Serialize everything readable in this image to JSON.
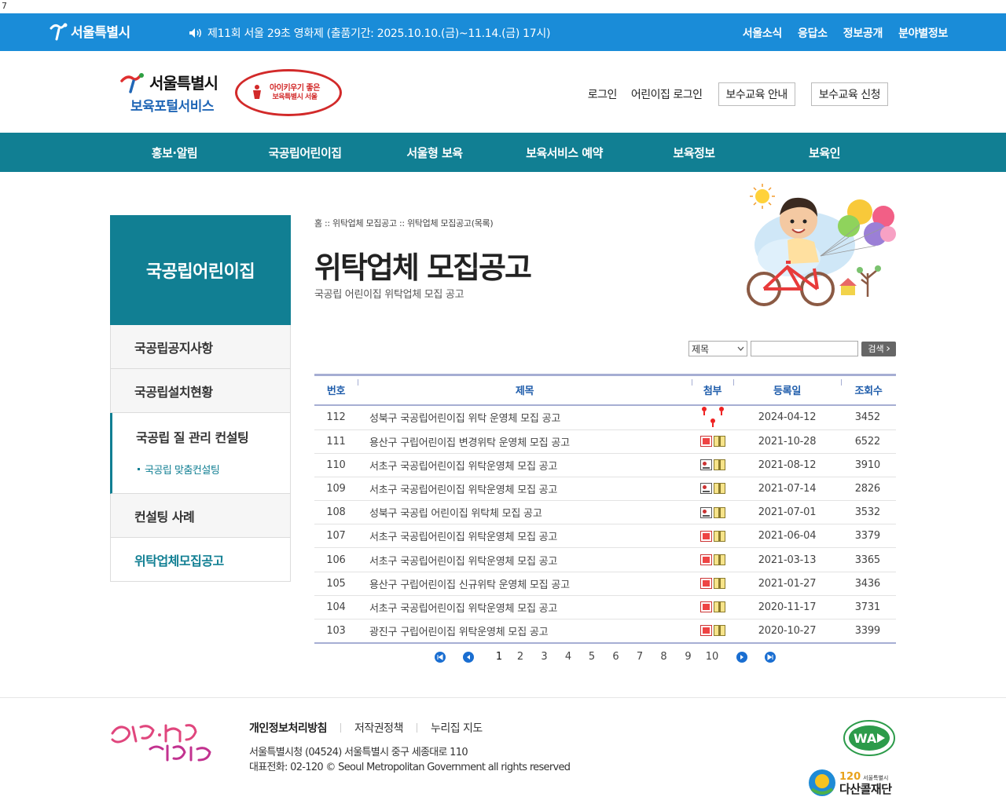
{
  "stray_char": "7",
  "topbar": {
    "logo_text": "서울특별시",
    "notice": "제11회 서울 29초 영화제 (출품기간: 2025.10.10.(금)~11.14.(금) 17시)",
    "links": [
      "서울소식",
      "응답소",
      "정보공개",
      "분야별정보"
    ]
  },
  "header": {
    "logo_line1": "서울특별시",
    "logo_line2": "보육포털서비스",
    "sub_logo_line1": "아이키우기 좋은",
    "sub_logo_line2": "보육특별시 서울",
    "util_login": "로그인",
    "util_daycare_login": "어린이집 로그인",
    "util_btn1": "보수교육 안내",
    "util_btn2": "보수교육 신청"
  },
  "gnb": [
    "홍보·알림",
    "국공립어린이집",
    "서울형 보육",
    "보육서비스 예약",
    "보육정보",
    "보육인"
  ],
  "sidebar": {
    "title": "국공립어린이집",
    "item1": "국공립공지사항",
    "item2": "국공립설치현황",
    "item3": "국공립 질 관리 컨설팅",
    "item3_sub": "국공립 맞춤컨설팅",
    "item4": "컨설팅 사례",
    "item5": "위탁업체모집공고"
  },
  "content": {
    "breadcrumb": "홈 :: 위탁업체 모집공고 :: 위탁업체 모집공고(목록)",
    "title": "위탁업체 모집공고",
    "subtitle": "국공립 어린이집 위탁업체 모집 공고"
  },
  "search": {
    "select_value": "제목",
    "input_value": "",
    "button": "검색"
  },
  "table": {
    "headers": [
      "번호",
      "제목",
      "첨부",
      "등록일",
      "조회수"
    ],
    "rows": [
      {
        "num": "112",
        "title": "성북구 국공립어린이집 위탁 운영체 모집 공고",
        "att": [
          "red",
          "red",
          "red"
        ],
        "date": "2024-04-12",
        "views": "3452"
      },
      {
        "num": "111",
        "title": "용산구 구립어린이집 변경위탁 운영체 모집 공고",
        "att": [
          "pdf",
          "zip"
        ],
        "date": "2021-10-28",
        "views": "6522"
      },
      {
        "num": "110",
        "title": "서초구 국공립어린이집 위탁운영체 모집 공고",
        "att": [
          "hwp",
          "zip"
        ],
        "date": "2021-08-12",
        "views": "3910"
      },
      {
        "num": "109",
        "title": "서초구 국공립어린이집 위탁운영체 모집 공고",
        "att": [
          "hwp",
          "zip"
        ],
        "date": "2021-07-14",
        "views": "2826"
      },
      {
        "num": "108",
        "title": "성북구 국공립 어린이집 위탁체 모집 공고",
        "att": [
          "hwp",
          "zip"
        ],
        "date": "2021-07-01",
        "views": "3532"
      },
      {
        "num": "107",
        "title": "서초구 국공립어린이집 위탁운영체 모집 공고",
        "att": [
          "pdf",
          "zip"
        ],
        "date": "2021-06-04",
        "views": "3379"
      },
      {
        "num": "106",
        "title": "서초구 국공립어린이집 위탁운영체 모집 공고",
        "att": [
          "pdf",
          "zip"
        ],
        "date": "2021-03-13",
        "views": "3365"
      },
      {
        "num": "105",
        "title": "용산구 구립어린이집 신규위탁 운영체 모집 공고",
        "att": [
          "pdf",
          "zip"
        ],
        "date": "2021-01-27",
        "views": "3436"
      },
      {
        "num": "104",
        "title": "서초구 국공립어린이집 위탁운영체 모집 공고",
        "att": [
          "pdf",
          "zip"
        ],
        "date": "2020-11-17",
        "views": "3731"
      },
      {
        "num": "103",
        "title": "광진구 구립어린이집 위탁운영체 모집 공고",
        "att": [
          "pdf",
          "zip"
        ],
        "date": "2020-10-27",
        "views": "3399"
      }
    ]
  },
  "pager": {
    "pages": [
      "1",
      "2",
      "3",
      "4",
      "5",
      "6",
      "7",
      "8",
      "9",
      "10"
    ],
    "current": "1"
  },
  "footer": {
    "link1": "개인정보처리방침",
    "link2": "저작권정책",
    "link3": "누리집 지도",
    "addr1": "서울특별시청 (04524) 서울특별시 중구 세종대로 110",
    "addr2": "대표전화: 02-120 © Seoul Metropolitan Government all rights reserved",
    "dasan_num": "120",
    "dasan_small": "서울특별시",
    "dasan_name": "다산콜재단"
  },
  "colors": {
    "topbar": "#1a8cd8",
    "gnb": "#117f93",
    "table_border": "#a6aed3",
    "header_text": "#1f5dab"
  }
}
